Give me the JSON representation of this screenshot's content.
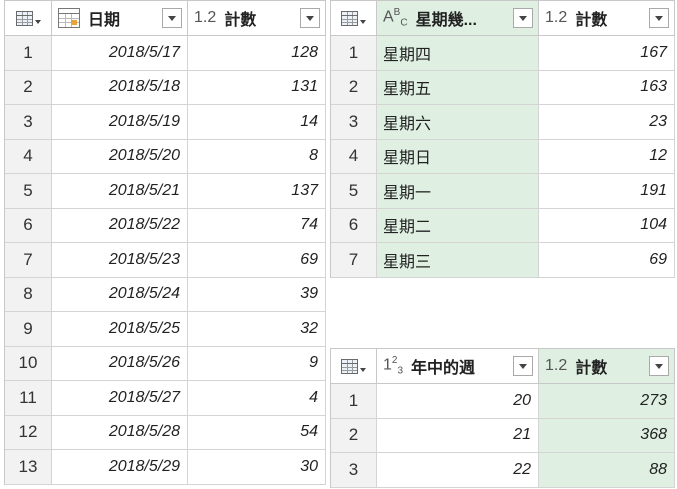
{
  "table_left": {
    "columns": [
      {
        "name": "日期",
        "type_icon": "calendar-icon"
      },
      {
        "name": "計數",
        "type_label": "1.2"
      }
    ],
    "rows": [
      {
        "index": "1",
        "date": "2018/5/17",
        "count": "128"
      },
      {
        "index": "2",
        "date": "2018/5/18",
        "count": "131"
      },
      {
        "index": "3",
        "date": "2018/5/19",
        "count": "14"
      },
      {
        "index": "4",
        "date": "2018/5/20",
        "count": "8"
      },
      {
        "index": "5",
        "date": "2018/5/21",
        "count": "137"
      },
      {
        "index": "6",
        "date": "2018/5/22",
        "count": "74"
      },
      {
        "index": "7",
        "date": "2018/5/23",
        "count": "69"
      },
      {
        "index": "8",
        "date": "2018/5/24",
        "count": "39"
      },
      {
        "index": "9",
        "date": "2018/5/25",
        "count": "32"
      },
      {
        "index": "10",
        "date": "2018/5/26",
        "count": "9"
      },
      {
        "index": "11",
        "date": "2018/5/27",
        "count": "4"
      },
      {
        "index": "12",
        "date": "2018/5/28",
        "count": "54"
      },
      {
        "index": "13",
        "date": "2018/5/29",
        "count": "30"
      }
    ]
  },
  "table_weekday": {
    "columns": [
      {
        "name": "星期幾...",
        "type_label": "ABC"
      },
      {
        "name": "計數",
        "type_label": "1.2"
      }
    ],
    "rows": [
      {
        "index": "1",
        "day": "星期四",
        "count": "167"
      },
      {
        "index": "2",
        "day": "星期五",
        "count": "163"
      },
      {
        "index": "3",
        "day": "星期六",
        "count": "23"
      },
      {
        "index": "4",
        "day": "星期日",
        "count": "12"
      },
      {
        "index": "5",
        "day": "星期一",
        "count": "191"
      },
      {
        "index": "6",
        "day": "星期二",
        "count": "104"
      },
      {
        "index": "7",
        "day": "星期三",
        "count": "69"
      }
    ]
  },
  "table_week": {
    "columns": [
      {
        "name": "年中的週",
        "type_label": "123"
      },
      {
        "name": "計數",
        "type_label": "1.2"
      }
    ],
    "rows": [
      {
        "index": "1",
        "week": "20",
        "count": "273"
      },
      {
        "index": "2",
        "week": "21",
        "count": "368"
      },
      {
        "index": "3",
        "week": "22",
        "count": "88"
      }
    ]
  },
  "colors": {
    "selected_column": "#dff0e3",
    "index_column": "#f2f2f2",
    "grid_line": "#d4d4d4"
  }
}
